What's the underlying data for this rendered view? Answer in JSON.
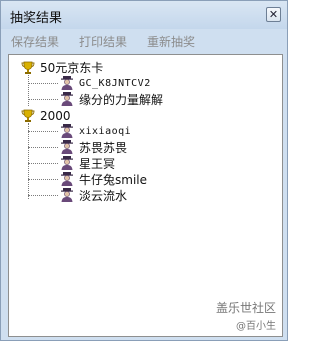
{
  "window": {
    "title": "抽奖结果",
    "close_label": "✕"
  },
  "menu": {
    "items": [
      "保存结果",
      "打印结果",
      "重新抽奖"
    ]
  },
  "tree": {
    "groups": [
      {
        "label": "50元京东卡",
        "icon": "trophy-icon",
        "users": [
          {
            "label": "GC_K8JNTCV2",
            "icon": "user-avatar-icon"
          },
          {
            "label": "缘分的力量解解",
            "icon": "user-avatar-icon"
          }
        ]
      },
      {
        "label": "2000",
        "icon": "trophy-icon",
        "users": [
          {
            "label": "xixiaoqi",
            "icon": "user-avatar-icon"
          },
          {
            "label": "苏畏苏畏",
            "icon": "user-avatar-icon"
          },
          {
            "label": "星王冥",
            "icon": "user-avatar-icon"
          },
          {
            "label": "牛仔兔smile",
            "icon": "user-avatar-icon"
          },
          {
            "label": "淡云流水",
            "icon": "user-avatar-icon"
          }
        ]
      }
    ]
  },
  "watermark": {
    "site": "盖乐世社区",
    "author": "@百小生"
  },
  "colors": {
    "window_bg": "#cfdff0",
    "menu_text_disabled": "#8c8c8c",
    "trophy_gold": "#c8a000",
    "avatar_purple": "#6a4a7a"
  }
}
